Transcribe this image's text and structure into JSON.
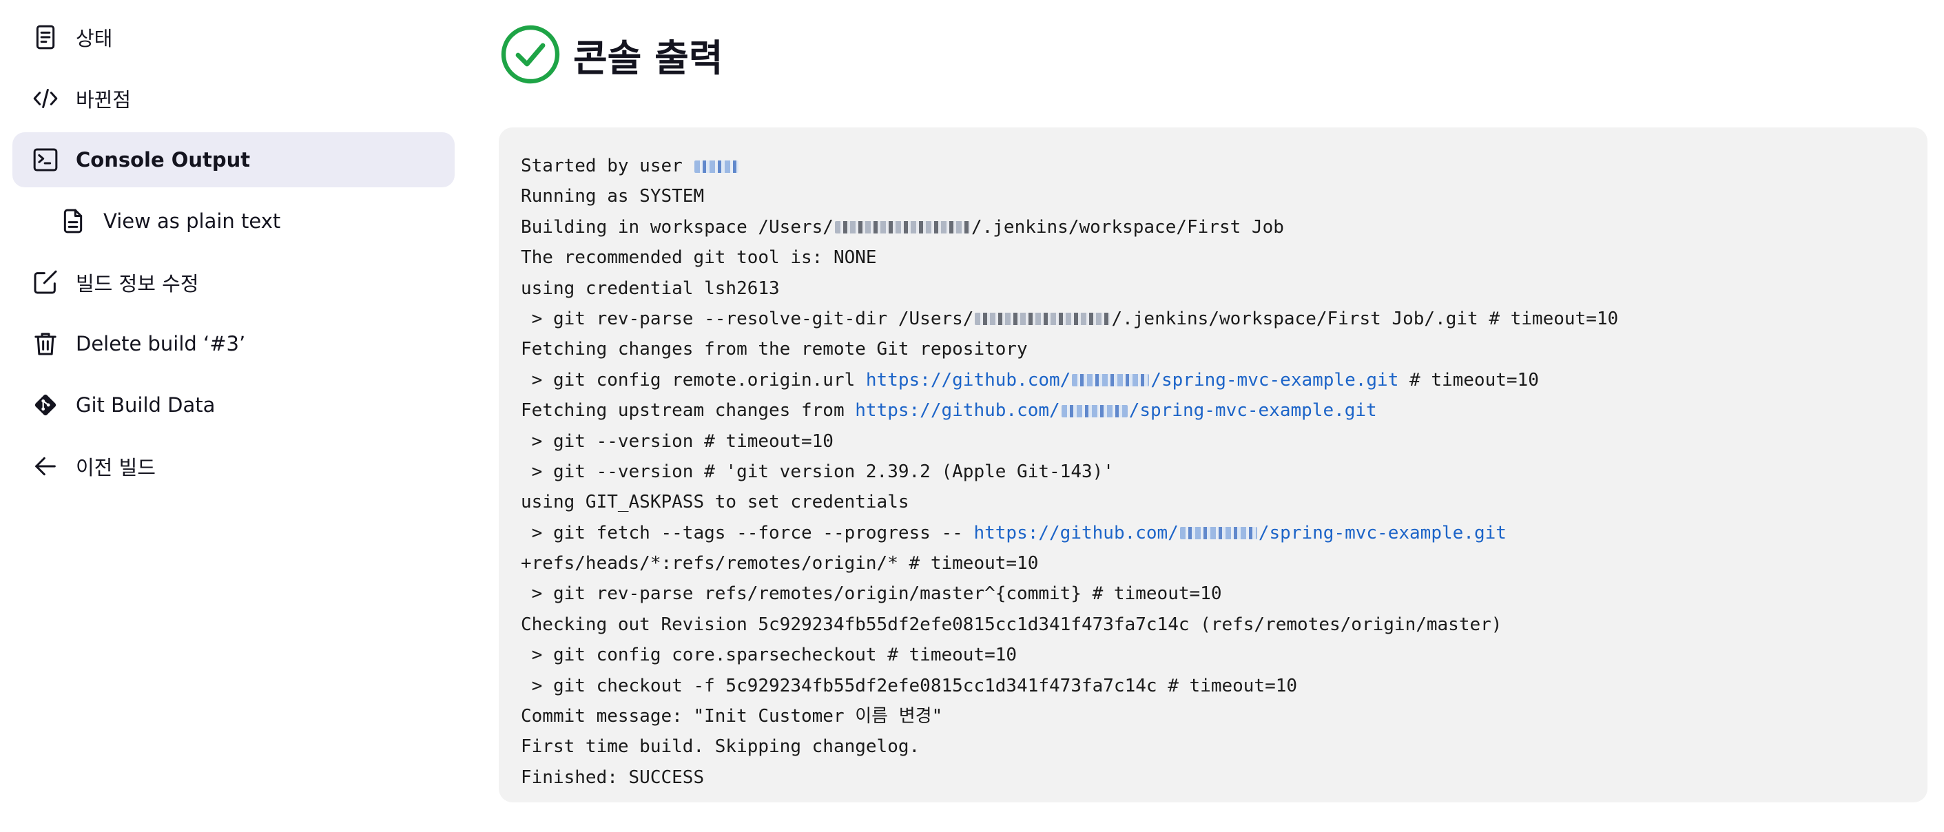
{
  "sidebar": {
    "items": [
      {
        "label": "상태",
        "icon": "status-document-icon"
      },
      {
        "label": "바뀐점",
        "icon": "code-icon"
      },
      {
        "label": "Console Output",
        "icon": "terminal-icon",
        "active": true
      },
      {
        "label": "View as plain text",
        "icon": "file-text-icon"
      },
      {
        "label": "빌드 정보 수정",
        "icon": "edit-icon"
      },
      {
        "label": "Delete build ‘#3’",
        "icon": "trash-icon"
      },
      {
        "label": "Git Build Data",
        "icon": "git-icon"
      },
      {
        "label": "이전 빌드",
        "icon": "arrow-left-icon"
      }
    ]
  },
  "header": {
    "title": "콘솔 출력",
    "status_icon": "success-check-icon",
    "status_color": "#1ea446"
  },
  "console": {
    "lines": [
      {
        "a": "Started by user "
      },
      {
        "a": "Running as SYSTEM"
      },
      {
        "a": "Building in workspace /Users/",
        "b": "/.jenkins/workspace/First Job"
      },
      {
        "a": "The recommended git tool is: NONE"
      },
      {
        "a": "using credential lsh2613"
      },
      {
        "a": " > git rev-parse --resolve-git-dir /Users/",
        "b": "/.jenkins/workspace/First Job/.git # timeout=10"
      },
      {
        "a": "Fetching changes from the remote Git repository"
      },
      {
        "a": " > git config remote.origin.url ",
        "link1": "https://github.com/",
        "link2": "/spring-mvc-example.git",
        "c": " # timeout=10"
      },
      {
        "a": "Fetching upstream changes from ",
        "link1": "https://github.com/",
        "link2": "/spring-mvc-example.git"
      },
      {
        "a": " > git --version # timeout=10"
      },
      {
        "a": " > git --version # 'git version 2.39.2 (Apple Git-143)'"
      },
      {
        "a": "using GIT_ASKPASS to set credentials"
      },
      {
        "a": " > git fetch --tags --force --progress -- ",
        "link1": "https://github.com/",
        "link2": "/spring-mvc-example.git"
      },
      {
        "a": "+refs/heads/*:refs/remotes/origin/* # timeout=10"
      },
      {
        "a": " > git rev-parse refs/remotes/origin/master^{commit} # timeout=10"
      },
      {
        "a": "Checking out Revision 5c929234fb55df2efe0815cc1d341f473fa7c14c (refs/remotes/origin/master)"
      },
      {
        "a": " > git config core.sparsecheckout # timeout=10"
      },
      {
        "a": " > git checkout -f 5c929234fb55df2efe0815cc1d341f473fa7c14c # timeout=10"
      },
      {
        "a": "Commit message: \"Init Customer 이름 변경\""
      },
      {
        "a": "First time build. Skipping changelog."
      },
      {
        "a": "Finished: SUCCESS"
      }
    ]
  },
  "colors": {
    "link": "#1c64c8",
    "active_bg": "#ebebf5",
    "console_bg": "#f2f2f2"
  }
}
